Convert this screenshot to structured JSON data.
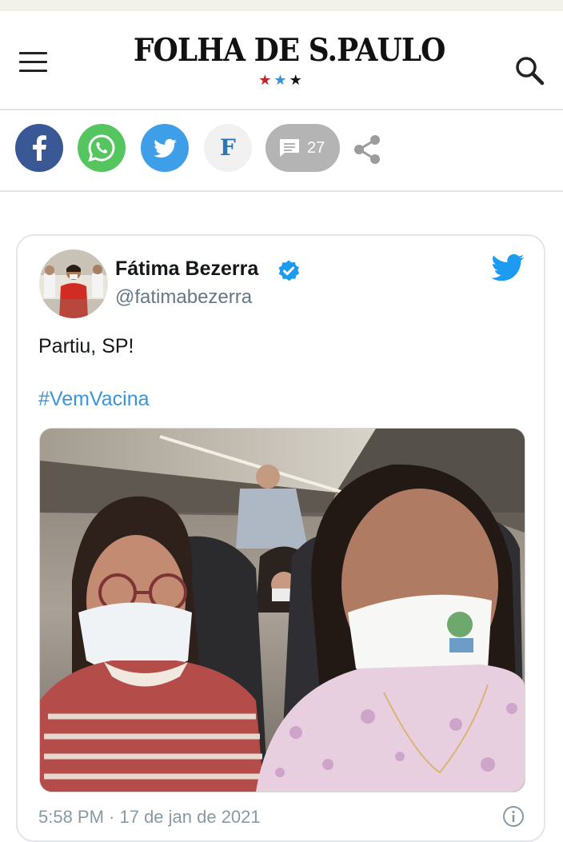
{
  "header": {
    "logo_text": "FOLHA DE S.PAULO",
    "stars": [
      "★",
      "★",
      "★"
    ],
    "menu_icon": "hamburger-menu-icon",
    "search_icon": "search-icon"
  },
  "share_bar": {
    "facebook_icon": "facebook-icon",
    "whatsapp_icon": "whatsapp-icon",
    "twitter_icon": "twitter-icon",
    "folha_letter": "F",
    "comment_count": "27",
    "share_icon": "share-icon",
    "colors": {
      "facebook": "#3a5796",
      "whatsapp": "#55c65f",
      "twitter": "#3e9ee8",
      "comments": "#b4b4b4"
    }
  },
  "tweet": {
    "author_name": "Fátima Bezerra",
    "author_handle": "@fatimabezerra",
    "verified": true,
    "text": "Partiu, SP!",
    "hashtag": "#VemVacina",
    "timestamp": "5:58 PM · 17 de jan de 2021",
    "hashtag_color": "#3b94d9"
  }
}
